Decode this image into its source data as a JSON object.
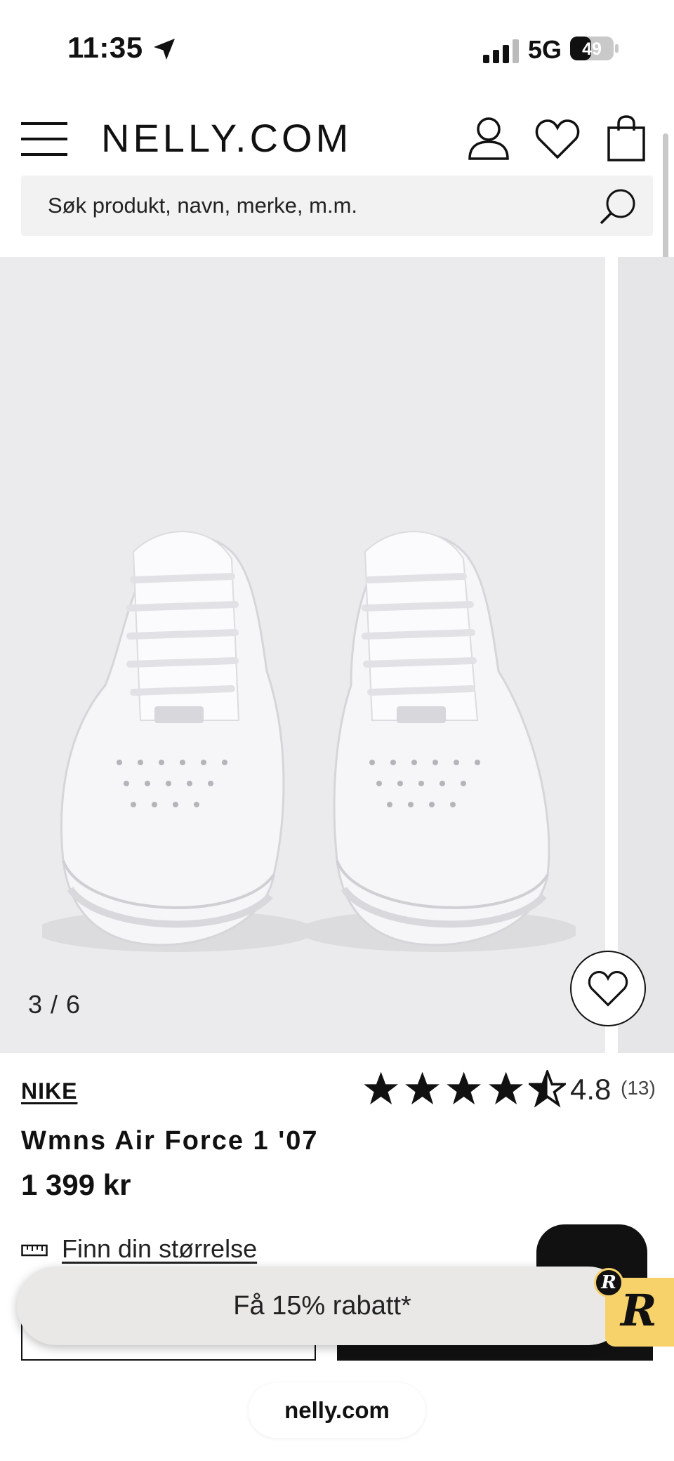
{
  "status_bar": {
    "time": "11:35",
    "network": "5G",
    "battery": "49",
    "icons": [
      "location-arrow-icon",
      "signal-icon",
      "battery-icon"
    ]
  },
  "header": {
    "logo": "NELLY.COM",
    "icons": [
      "menu-icon",
      "user-icon",
      "heart-icon",
      "bag-icon"
    ]
  },
  "search": {
    "placeholder": "Søk produkt, navn, merke, m.m."
  },
  "gallery": {
    "counter": "3 / 6"
  },
  "product": {
    "brand": "NIKE",
    "name": "Wmns Air Force 1 '07",
    "price": "1 399 kr",
    "rating": "4.8",
    "rating_count": "(13)",
    "rating_value": 4.8,
    "rating_max": 5
  },
  "size_link": "Finn din størrelse",
  "promo": {
    "text": "Få 15% rabatt*",
    "badge": "R"
  },
  "browser": {
    "url": "nelly.com"
  },
  "colors": {
    "accent": "#111111",
    "badge": "#f7d26b",
    "gallery_bg": "#ebebed"
  }
}
